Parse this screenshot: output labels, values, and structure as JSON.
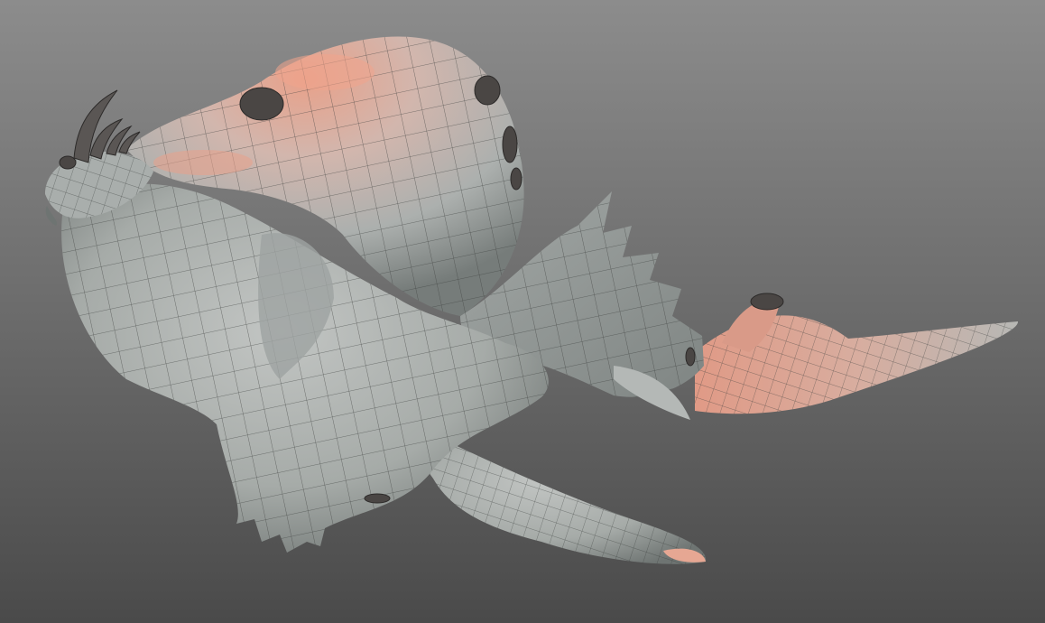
{
  "scene": {
    "subject": "sculpted-creature-mesh",
    "render_style": "wireframe-on-shaded",
    "colors": {
      "background_top": "#8c8c8c",
      "background_bottom": "#4a4a4a",
      "skin_base": "#a6aba8",
      "skin_shadow": "#6e7472",
      "highlight_warm": "#e8a18a",
      "wire": "#3b3d3c",
      "barnacle": "#4a4644"
    },
    "grid": true
  }
}
